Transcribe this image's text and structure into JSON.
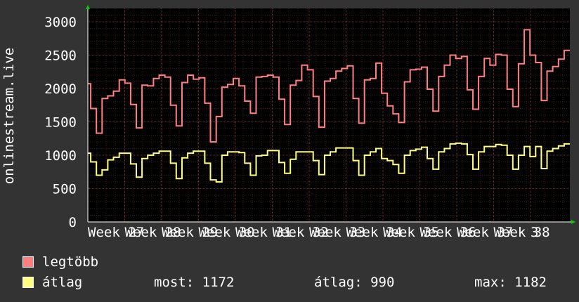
{
  "chart_data": {
    "type": "line",
    "title": "",
    "ylabel": "onlinestream.live",
    "ylim": [
      0,
      3200
    ],
    "yticks": [
      0,
      500,
      1000,
      1500,
      2000,
      2500,
      3000
    ],
    "xtick_labels": [
      "Week 27",
      "Week 28",
      "Week 29",
      "Week 30",
      "Week 31",
      "Week 32",
      "Week 33",
      "Week 34",
      "Week 35",
      "Week 36",
      "Week 37",
      "Week 38",
      "3"
    ],
    "grid": true,
    "colors": {
      "background": "#333333",
      "plot": "#000000",
      "grid_minor": "#3d1a1a",
      "grid_major": "#6e2a2a",
      "axis": "#ffffff",
      "arrow": "#00cc00"
    },
    "series": [
      {
        "name": "legtöbb",
        "color": "#ff8080",
        "values": [
          2070,
          1700,
          1700,
          1330,
          1330,
          1850,
          1850,
          1890,
          1890,
          1960,
          1960,
          2130,
          2130,
          2080,
          2080,
          1760,
          1760,
          1410,
          1410,
          2050,
          2050,
          2040,
          2040,
          2150,
          2150,
          2200,
          2200,
          2170,
          2170,
          1750,
          1750,
          1440,
          1440,
          2090,
          2090,
          2200,
          2200,
          2140,
          2140,
          2160,
          2160,
          1780,
          1780,
          1200,
          1200,
          1580,
          1580,
          2020,
          2020,
          2060,
          2060,
          2150,
          2150,
          2040,
          2040,
          1810,
          1810,
          1630,
          1630,
          2170,
          2170,
          2180,
          2180,
          2200,
          2200,
          2170,
          2170,
          1840,
          1840,
          1460,
          1460,
          2050,
          2050,
          2120,
          2120,
          2350,
          2350,
          2280,
          2280,
          1880,
          1880,
          1420,
          1420,
          2110,
          2110,
          2150,
          2150,
          2260,
          2260,
          2300,
          2300,
          2340,
          2340,
          1850,
          1850,
          1480,
          1480,
          2130,
          2130,
          2150,
          2150,
          2380,
          2380,
          1930,
          1930,
          1740,
          1740,
          1620,
          1620,
          1490,
          1490,
          2100,
          2100,
          2280,
          2280,
          2290,
          2290,
          2320,
          2320,
          1990,
          1990,
          1660,
          1660,
          2180,
          2180,
          2350,
          2350,
          2500,
          2500,
          2450,
          2450,
          2480,
          2480,
          1980,
          1980,
          1690,
          1690,
          2180,
          2180,
          2450,
          2450,
          2350,
          2350,
          2510,
          2510,
          2500,
          2500,
          1990,
          1990,
          1730,
          1730,
          2370,
          2370,
          2880,
          2880,
          2500,
          2500,
          2390,
          2390,
          1820,
          1820,
          2260,
          2260,
          2330,
          2330,
          2440,
          2440,
          2570,
          2570
        ]
      },
      {
        "name": "átlag",
        "color": "#ffff80",
        "values": [
          1030,
          900,
          900,
          700,
          700,
          780,
          780,
          930,
          930,
          970,
          970,
          1030,
          1030,
          1030,
          1030,
          870,
          870,
          670,
          670,
          950,
          950,
          1000,
          1000,
          1030,
          1030,
          1060,
          1060,
          1060,
          1060,
          880,
          880,
          650,
          650,
          960,
          960,
          1030,
          1030,
          1060,
          1060,
          1060,
          1060,
          880,
          880,
          630,
          630,
          600,
          600,
          1000,
          1000,
          1050,
          1050,
          1050,
          1050,
          1040,
          1040,
          880,
          880,
          700,
          700,
          990,
          990,
          1000,
          1000,
          1070,
          1070,
          1070,
          1070,
          890,
          890,
          730,
          730,
          940,
          940,
          1050,
          1050,
          1050,
          1050,
          1050,
          1050,
          920,
          920,
          710,
          710,
          1000,
          1000,
          1050,
          1050,
          1110,
          1110,
          1110,
          1110,
          1110,
          1110,
          920,
          920,
          700,
          700,
          1000,
          1000,
          1050,
          1050,
          1100,
          1100,
          950,
          950,
          920,
          920,
          860,
          860,
          730,
          730,
          1000,
          1000,
          1070,
          1070,
          1090,
          1090,
          1120,
          1120,
          950,
          950,
          790,
          790,
          1050,
          1050,
          1100,
          1100,
          1170,
          1170,
          1180,
          1180,
          1170,
          1170,
          1010,
          1010,
          790,
          790,
          1050,
          1050,
          1130,
          1130,
          1130,
          1130,
          1160,
          1160,
          1150,
          1150,
          1000,
          1000,
          790,
          790,
          1000,
          1000,
          1130,
          1130,
          980,
          980,
          1130,
          1130,
          800,
          800,
          1060,
          1060,
          1100,
          1100,
          1140,
          1140,
          1170,
          1170
        ]
      }
    ]
  },
  "legend": [
    {
      "label": "legtöbb",
      "color": "#ff8080"
    },
    {
      "label": "átlag",
      "color": "#ffff80"
    }
  ],
  "stats": {
    "most": "most: 1172",
    "atlag": "átlag: 990",
    "max": "max: 1182"
  }
}
